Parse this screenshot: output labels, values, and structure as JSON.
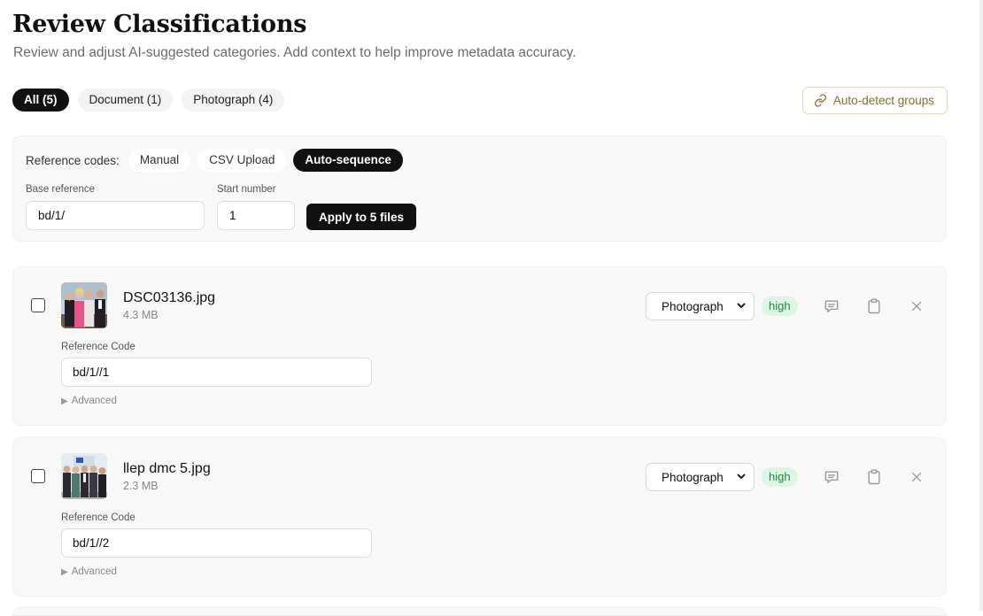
{
  "header": {
    "title": "Review Classifications",
    "subtitle": "Review and adjust AI-suggested categories. Add context to help improve metadata accuracy."
  },
  "filters": [
    {
      "label": "All (5)",
      "active": true
    },
    {
      "label": "Document (1)",
      "active": false
    },
    {
      "label": "Photograph (4)",
      "active": false
    }
  ],
  "auto_detect": {
    "label": "Auto-detect groups",
    "icon": "link-icon"
  },
  "reference": {
    "label": "Reference codes:",
    "modes": [
      {
        "label": "Manual",
        "active": false
      },
      {
        "label": "CSV Upload",
        "active": false
      },
      {
        "label": "Auto-sequence",
        "active": true
      }
    ],
    "base_label": "Base reference",
    "base_value": "bd/1/",
    "start_label": "Start number",
    "start_value": "1",
    "apply_label": "Apply to 5 files"
  },
  "files": [
    {
      "name": "DSC03136.jpg",
      "size": "4.3 MB",
      "type": "Photograph",
      "confidence": "high",
      "ref_label": "Reference Code",
      "ref_value": "bd/1//1",
      "advanced_label": "Advanced"
    },
    {
      "name": "llep dmc 5.jpg",
      "size": "2.3 MB",
      "type": "Photograph",
      "confidence": "high",
      "ref_label": "Reference Code",
      "ref_value": "bd/1//2",
      "advanced_label": "Advanced"
    }
  ],
  "colors": {
    "accent_dark": "#111111",
    "badge_bg": "#dcf5e4",
    "badge_text": "#1e8a44",
    "auto_detect_text": "#8a6d2c"
  }
}
